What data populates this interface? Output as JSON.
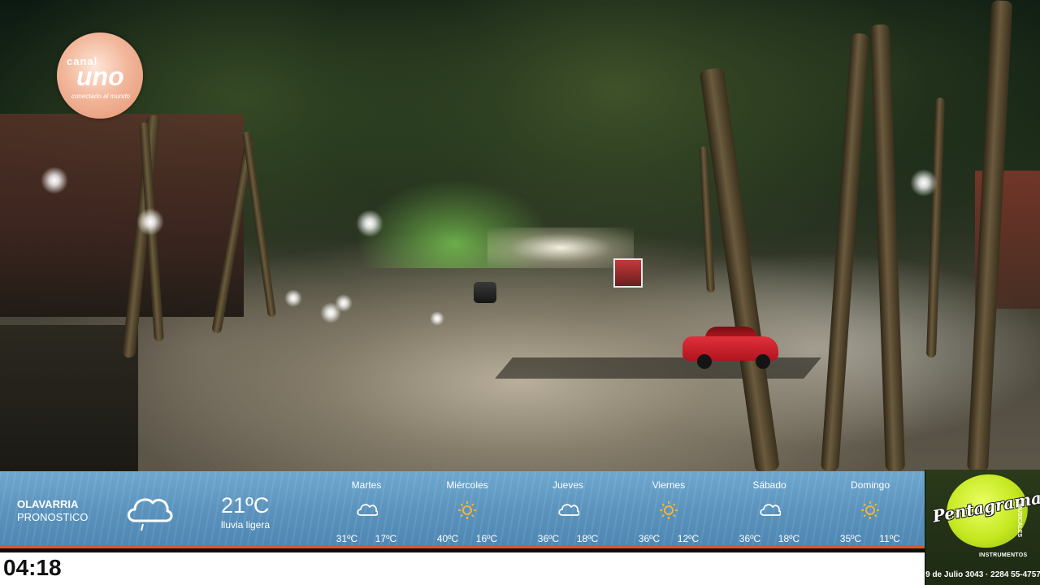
{
  "watermark": {
    "channel": "canal",
    "brand": "uno",
    "tagline": "conectado al mundo"
  },
  "weather": {
    "city": "OLAVARRIA",
    "subtitle": "PRONOSTICO",
    "current": {
      "icon": "cloud-rain-icon",
      "temp": "21ºC",
      "description": "lluvia ligera"
    },
    "days": [
      {
        "name": "Martes",
        "icon": "cloud-icon",
        "max": "31ºC",
        "min": "17ºC"
      },
      {
        "name": "Miércoles",
        "icon": "sun-icon",
        "max": "40ºC",
        "min": "16ºC"
      },
      {
        "name": "Jueves",
        "icon": "cloud-icon",
        "max": "36ºC",
        "min": "18ºC"
      },
      {
        "name": "Viernes",
        "icon": "sun-icon",
        "max": "36ºC",
        "min": "12ºC"
      },
      {
        "name": "Sábado",
        "icon": "cloud-icon",
        "max": "36ºC",
        "min": "18ºC"
      },
      {
        "name": "Domingo",
        "icon": "sun-icon",
        "max": "35ºC",
        "min": "11ºC"
      }
    ],
    "colors": {
      "accent": "#e2552a",
      "bar": "#5b93bd",
      "sun": "#f5b335"
    }
  },
  "clock": {
    "time": "04:18"
  },
  "sponsor": {
    "name": "Pentagrama",
    "subtitle": "INSTRUMENTOS",
    "side_text": "MUSICALES",
    "address": "9 de Julio 3043 · 2284 55-4757",
    "accent": "#c5e820"
  }
}
